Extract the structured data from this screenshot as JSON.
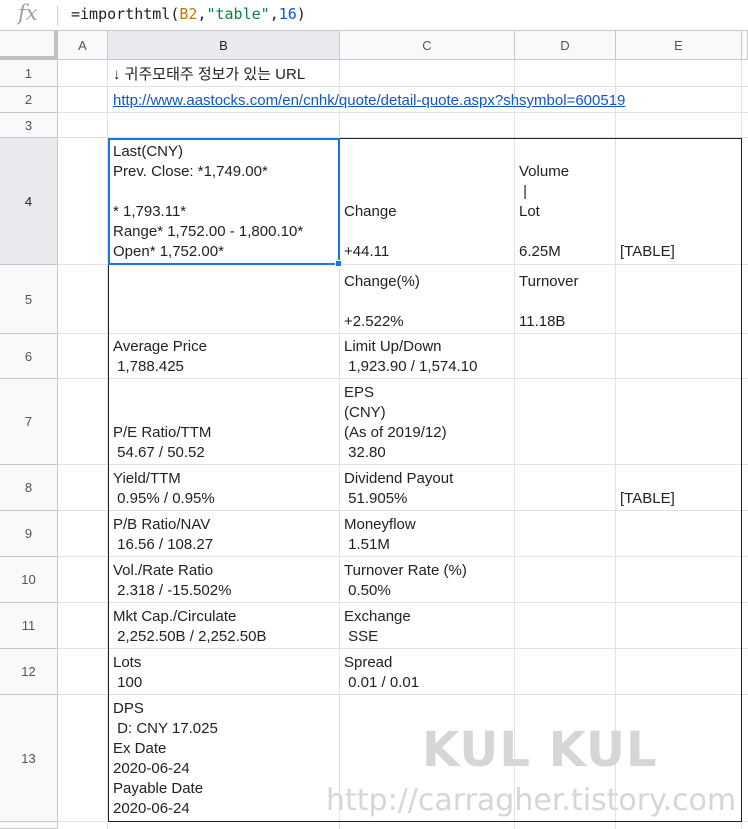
{
  "formula_bar": {
    "icon": "fx-icon",
    "formula_prefix": "=importhtml(",
    "formula_ref": "B2",
    "formula_sep1": ",",
    "formula_str": "\"table\"",
    "formula_sep2": ",",
    "formula_num": "16",
    "formula_suffix": ")"
  },
  "columns": [
    "A",
    "B",
    "C",
    "D",
    "E"
  ],
  "rows": [
    "1",
    "2",
    "3",
    "4",
    "5",
    "6",
    "7",
    "8",
    "9",
    "10",
    "11",
    "12",
    "13"
  ],
  "cells": {
    "B1": "↓ 귀주모태주 정보가 있는 URL",
    "B2": "http://www.aastocks.com/en/cnhk/quote/detail-quote.aspx?shsymbol=600519",
    "B4": "Last(CNY)\nPrev. Close: *1,749.00*\n\n* 1,793.11*\nRange* 1,752.00 - 1,800.10*\nOpen* 1,752.00*",
    "C4": "Change\n\n+44.11",
    "D4": "Volume\n |\nLot\n\n6.25M",
    "E4": "[TABLE]",
    "C5": "Change(%)\n\n+2.522%",
    "D5": "Turnover\n\n11.18B",
    "B6": "Average Price\n 1,788.425",
    "C6": "Limit Up/Down\n 1,923.90 / 1,574.10",
    "B7": "P/E Ratio/TTM\n 54.67 / 50.52",
    "C7": "EPS\n(CNY)\n(As of 2019/12)\n 32.80",
    "B8": "Yield/TTM\n 0.95% / 0.95%",
    "C8": "Dividend Payout\n 51.905%",
    "E8": "[TABLE]",
    "B9": "P/B Ratio/NAV\n 16.56 / 108.27",
    "C9": "Moneyflow\n 1.51M",
    "B10": "Vol./Rate Ratio\n 2.318 / -15.502%",
    "C10": "Turnover Rate (%)\n 0.50%",
    "B11": "Mkt Cap./Circulate\n 2,252.50B / 2,252.50B",
    "C11": "Exchange\n SSE",
    "B12": "Lots\n 100",
    "C12": "Spread\n 0.01 / 0.01",
    "B13": "DPS\n D: CNY 17.025\nEx Date\n2020-06-24\nPayable Date\n2020-06-24"
  },
  "selected_cell": "B4",
  "colors": {
    "selection": "#1a73e8",
    "link": "#1155cc",
    "formula_ref": "#c27a00",
    "formula_str": "#0b8043",
    "formula_num": "#1155cc"
  },
  "watermark": {
    "line1": "KUL KUL",
    "line2": "http://carragher.tistory.com"
  }
}
